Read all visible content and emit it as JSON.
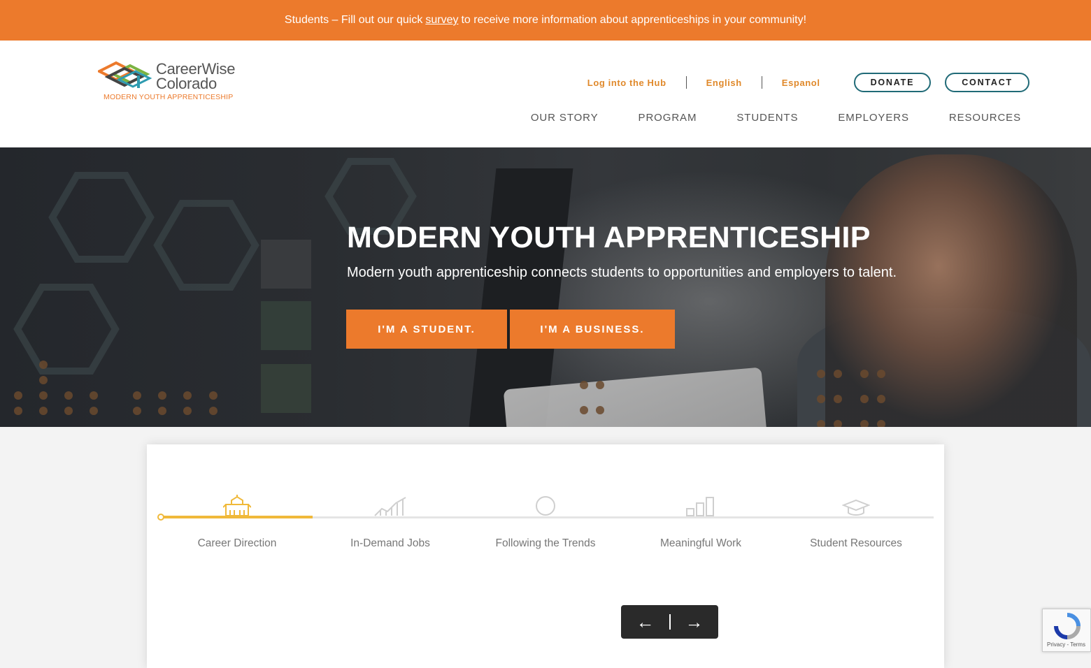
{
  "banner": {
    "text_before": "Students – Fill out our quick",
    "link": "survey",
    "text_after": "to receive more information about apprenticeships in your community!"
  },
  "logo": {
    "name_line1": "CareerWise",
    "name_line2": "Colorado",
    "tagline": "MODERN YOUTH APPRENTICESHIP"
  },
  "utility_nav": {
    "hub": "Log into the Hub",
    "english": "English",
    "espanol": "Espanol",
    "donate": "DONATE",
    "contact": "CONTACT"
  },
  "main_nav": [
    "OUR STORY",
    "PROGRAM",
    "STUDENTS",
    "EMPLOYERS",
    "RESOURCES"
  ],
  "hero": {
    "title": "MODERN YOUTH APPRENTICESHIP",
    "subtitle": "Modern youth apprenticeship connects students to opportunities and employers to talent.",
    "student_button": "I'M A STUDENT.",
    "business_button": "I'M A BUSINESS."
  },
  "timeline": {
    "steps": [
      {
        "label": "Career Direction",
        "icon": "school-building-icon",
        "active": true
      },
      {
        "label": "In-Demand Jobs",
        "icon": "line-chart-icon",
        "active": false
      },
      {
        "label": "Following the Trends",
        "icon": "circle-icon",
        "active": false
      },
      {
        "label": "Meaningful Work",
        "icon": "bar-chart-icon",
        "active": false
      },
      {
        "label": "Student Resources",
        "icon": "graduation-cap-icon",
        "active": false
      }
    ],
    "prev": "←",
    "next": "→"
  },
  "recaptcha": {
    "text": "Privacy - Terms"
  },
  "colors": {
    "accent_orange": "#ec7a2c",
    "teal": "#206a77",
    "timeline_yellow": "#f0b93a"
  }
}
